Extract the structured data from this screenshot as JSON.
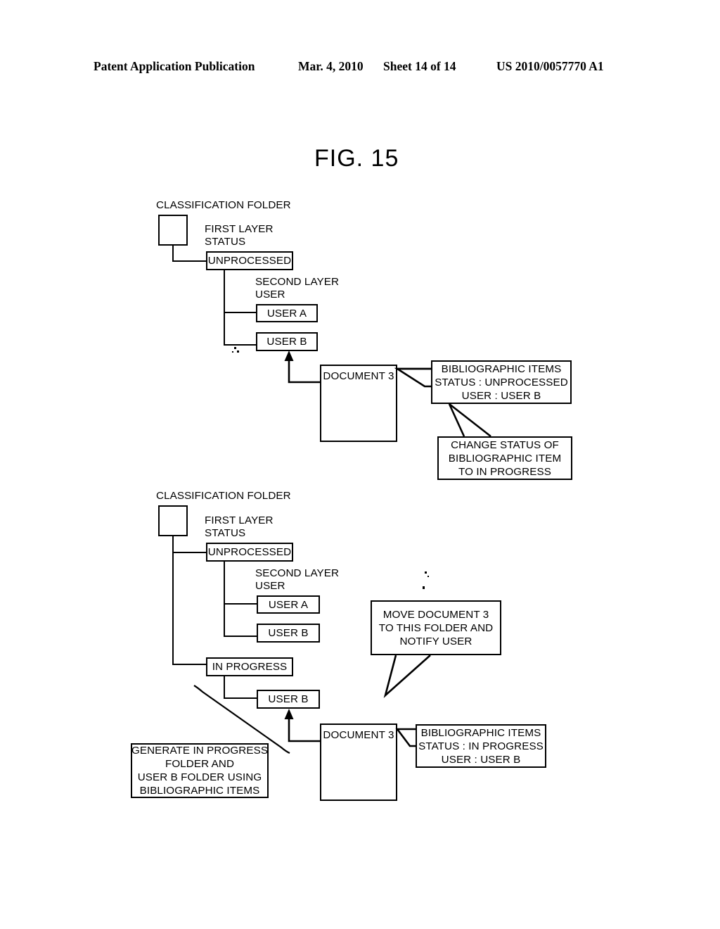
{
  "header": {
    "publication": "Patent Application Publication",
    "date": "Mar. 4, 2010",
    "sheet": "Sheet 14 of 14",
    "number": "US 2010/0057770 A1"
  },
  "figure": {
    "title": "FIG. 15"
  },
  "upper_diagram": {
    "root_label": "CLASSIFICATION FOLDER",
    "first_layer_label": "FIRST LAYER\nSTATUS",
    "second_layer_label": "SECOND LAYER\nUSER",
    "nodes": {
      "status_unprocessed": "UNPROCESSED",
      "user_a": "USER A",
      "user_b": "USER B",
      "document": "DOCUMENT 3"
    },
    "callouts": {
      "bibliographic": "BIBLIOGRAPHIC ITEMS\nSTATUS : UNPROCESSED\nUSER : USER B",
      "change_status": "CHANGE STATUS OF\nBIBLIOGRAPHIC ITEM\nTO IN PROGRESS"
    }
  },
  "lower_diagram": {
    "root_label": "CLASSIFICATION FOLDER",
    "first_layer_label": "FIRST LAYER\nSTATUS",
    "second_layer_label": "SECOND LAYER\nUSER",
    "nodes": {
      "status_unprocessed": "UNPROCESSED",
      "user_a": "USER A",
      "user_b": "USER B",
      "status_in_progress": "IN PROGRESS",
      "in_progress_user_b": "USER B",
      "document": "DOCUMENT 3"
    },
    "callouts": {
      "move_document": "MOVE DOCUMENT 3\nTO THIS FOLDER AND\nNOTIFY USER",
      "generate_folder": "GENERATE IN PROGRESS\nFOLDER AND\nUSER B FOLDER USING\nBIBLIOGRAPHIC ITEMS",
      "bibliographic": "BIBLIOGRAPHIC ITEMS\nSTATUS : IN PROGRESS\nUSER : USER B"
    }
  }
}
